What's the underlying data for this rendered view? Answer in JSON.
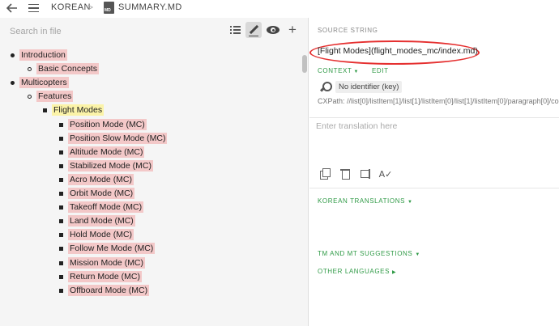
{
  "header": {
    "crumb_project": "KOREAN",
    "crumb_separator": ">",
    "crumb_file": "SUMMARY.MD",
    "file_icon_label": "MD"
  },
  "left_panel": {
    "search_placeholder": "Search in file",
    "tree": [
      {
        "label": "Introduction",
        "level": 0,
        "highlight": "red"
      },
      {
        "label": "Basic Concepts",
        "level": 1,
        "highlight": "red"
      },
      {
        "label": "Multicopters",
        "level": 0,
        "highlight": "red"
      },
      {
        "label": "Features",
        "level": 1,
        "highlight": "red"
      },
      {
        "label": "Flight Modes",
        "level": 2,
        "highlight": "yellow"
      },
      {
        "label": "Position Mode (MC)",
        "level": 3,
        "highlight": "red"
      },
      {
        "label": "Position Slow Mode (MC)",
        "level": 3,
        "highlight": "red"
      },
      {
        "label": "Altitude Mode (MC)",
        "level": 3,
        "highlight": "red"
      },
      {
        "label": "Stabilized Mode (MC)",
        "level": 3,
        "highlight": "red"
      },
      {
        "label": "Acro Mode (MC)",
        "level": 3,
        "highlight": "red"
      },
      {
        "label": "Orbit Mode (MC)",
        "level": 3,
        "highlight": "red"
      },
      {
        "label": "Takeoff Mode (MC)",
        "level": 3,
        "highlight": "red"
      },
      {
        "label": "Land Mode (MC)",
        "level": 3,
        "highlight": "red"
      },
      {
        "label": "Hold Mode (MC)",
        "level": 3,
        "highlight": "red"
      },
      {
        "label": "Follow Me Mode (MC)",
        "level": 3,
        "highlight": "red"
      },
      {
        "label": "Mission Mode (MC)",
        "level": 3,
        "highlight": "red"
      },
      {
        "label": "Return Mode (MC)",
        "level": 3,
        "highlight": "red"
      },
      {
        "label": "Offboard Mode (MC)",
        "level": 3,
        "highlight": "red"
      }
    ]
  },
  "right_panel": {
    "source_label": "SOURCE STRING",
    "source_string": "[Flight Modes](flight_modes_mc/index.md)",
    "context_label": "CONTEXT",
    "edit_label": "EDIT",
    "no_identifier": "No identifier (key)",
    "cxpath": "CXPath: //list[0]/listItem[1]/list[1]/listItem[0]/list[1]/listItem[0]/paragraph[0]/co",
    "translation_placeholder": "Enter translation here",
    "korean_translations_label": "KOREAN TRANSLATIONS",
    "tm_mt_label": "TM AND MT SUGGESTIONS",
    "other_languages_label": "OTHER LANGUAGES"
  },
  "colors": {
    "highlight_red": "#f3c8c8",
    "highlight_yellow": "#fbf3a8",
    "accent_green": "#2f9a46",
    "annotation_red": "#e53030"
  },
  "icons": [
    "back-arrow-icon",
    "menu-icon",
    "markdown-file-icon",
    "list-icon",
    "pencil-icon",
    "eye-icon",
    "plus-icon",
    "key-icon",
    "copy-icon",
    "trash-icon",
    "tm-icon",
    "spellcheck-icon"
  ]
}
